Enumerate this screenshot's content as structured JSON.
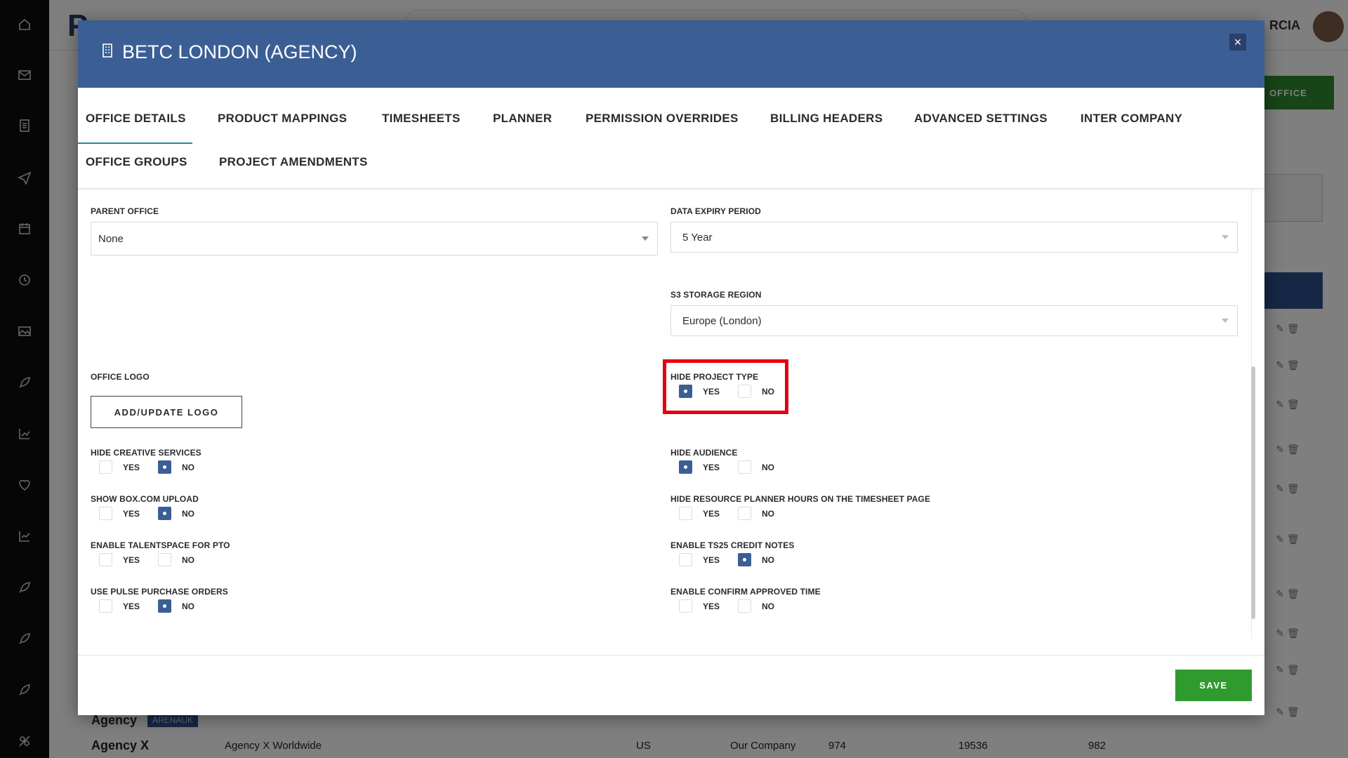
{
  "background": {
    "user_name": "RCIA",
    "new_office_label": "OFFICE",
    "rows": [
      {
        "name": "Agency",
        "tag": "ARENAUK"
      },
      {
        "name": "Agency X",
        "tag": ""
      }
    ],
    "row2_cells": [
      "Agency X Worldwide",
      "US",
      "Our Company",
      "974",
      "19536",
      "982"
    ]
  },
  "modal": {
    "title": "BETC LONDON (AGENCY)",
    "close_label": "×",
    "tabs": [
      "OFFICE DETAILS",
      "PRODUCT MAPPINGS",
      "TIMESHEETS",
      "PLANNER",
      "PERMISSION OVERRIDES",
      "BILLING HEADERS",
      "ADVANCED SETTINGS",
      "INTER COMPANY",
      "OFFICE GROUPS",
      "PROJECT AMENDMENTS"
    ],
    "active_tab": "OFFICE DETAILS",
    "fields": {
      "parent_office": {
        "label": "PARENT OFFICE",
        "value": "None"
      },
      "data_expiry": {
        "label": "DATA EXPIRY PERIOD",
        "value": "5 Year"
      },
      "s3_region": {
        "label": "S3 STORAGE REGION",
        "value": "Europe (London)"
      },
      "office_logo": {
        "label": "OFFICE LOGO",
        "button": "ADD/UPDATE LOGO"
      }
    },
    "yes_label": "YES",
    "no_label": "NO",
    "toggles": {
      "hide_project_type": {
        "label": "HIDE PROJECT TYPE",
        "value": "yes"
      },
      "hide_creative_services": {
        "label": "HIDE CREATIVE SERVICES",
        "value": "no"
      },
      "hide_audience": {
        "label": "HIDE AUDIENCE",
        "value": "yes"
      },
      "show_box_upload": {
        "label": "SHOW BOX.COM UPLOAD",
        "value": "no"
      },
      "hide_resource_planner_hours": {
        "label": "HIDE RESOURCE PLANNER HOURS ON THE TIMESHEET PAGE",
        "value": "none"
      },
      "enable_talentspace_pto": {
        "label": "ENABLE TALENTSPACE FOR PTO",
        "value": "none"
      },
      "enable_ts25_credit_notes": {
        "label": "ENABLE TS25 CREDIT NOTES",
        "value": "no"
      },
      "use_pulse_purchase_orders": {
        "label": "USE PULSE PURCHASE ORDERS",
        "value": "no"
      },
      "enable_confirm_approved_time": {
        "label": "ENABLE CONFIRM APPROVED TIME",
        "value": "none"
      }
    },
    "save_label": "SAVE"
  }
}
